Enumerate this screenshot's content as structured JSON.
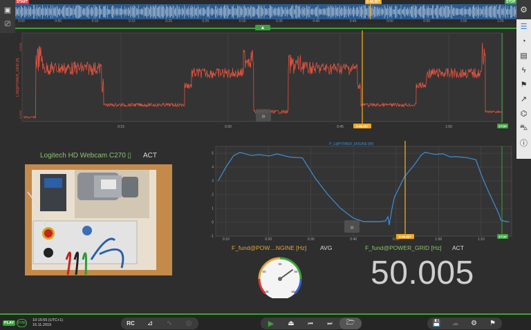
{
  "overview": {
    "start_label": "START",
    "stop_label": "STOP",
    "cursor_label": "0:46.957",
    "ticks": [
      "0:00",
      "0:05",
      "0:10",
      "0:15",
      "0:20",
      "0:25",
      "0:30",
      "0:35",
      "0:40",
      "0:45",
      "0:50",
      "0:55",
      "1:00",
      "1:05"
    ]
  },
  "top_chart": {
    "ylabel": "L1N@POWER_GRID [A]",
    "yticks": [
      "0,0000",
      "0,0000"
    ],
    "xticks": [
      "0:15",
      "0:30",
      "0:45",
      "1:00"
    ],
    "cursor_label": "0:46.957",
    "stop_label": "STOP",
    "line_color": "#e3533f",
    "cursor_color": "#f2a81d"
  },
  "webcam": {
    "title": "Logitech HD Webcam C270 ▯",
    "mode": "ACT"
  },
  "chart_data": {
    "type": "line",
    "title": "P_1@POWER_ENGINE [W]",
    "x": [
      "0:10",
      "0:20",
      "0:30",
      "0:40",
      "0:50",
      "1:00",
      "1:10"
    ],
    "yticks": [
      -1,
      0,
      1,
      2,
      3,
      4,
      5
    ],
    "ylim": [
      -1,
      5.5
    ],
    "cursor_label": "0:46.957",
    "stop_label": "STOP",
    "series": [
      {
        "color": "#3e8fd6",
        "points": [
          [
            0.07,
            3.0
          ],
          [
            0.1,
            4.0
          ],
          [
            0.13,
            4.8
          ],
          [
            0.155,
            5.1
          ],
          [
            0.2,
            4.85
          ],
          [
            0.23,
            4.9
          ],
          [
            0.27,
            4.75
          ],
          [
            0.3,
            4.9
          ],
          [
            0.35,
            4.75
          ],
          [
            0.4,
            4.6
          ],
          [
            0.45,
            3.2
          ],
          [
            0.5,
            2.0
          ],
          [
            0.55,
            1.0
          ],
          [
            0.6,
            0.3
          ],
          [
            0.64,
            0.05
          ],
          [
            0.7,
            0.05
          ],
          [
            0.725,
            0.1
          ],
          [
            0.735,
            0.4
          ],
          [
            0.74,
            -0.2
          ],
          [
            0.75,
            0.9
          ],
          [
            0.76,
            1.8
          ],
          [
            0.8,
            3.3
          ],
          [
            0.84,
            4.2
          ],
          [
            0.865,
            4.8
          ],
          [
            0.88,
            5.05
          ],
          [
            0.92,
            4.85
          ],
          [
            0.95,
            4.9
          ],
          [
            0.98,
            4.7
          ],
          [
            1.0,
            4.8
          ],
          [
            1.04,
            4.7
          ],
          [
            1.08,
            4.6
          ],
          [
            1.1,
            3.5
          ],
          [
            1.12,
            2.6
          ],
          [
            1.15,
            1.4
          ],
          [
            1.17,
            0.6
          ],
          [
            1.178,
            0.15
          ],
          [
            1.2,
            0.05
          ],
          [
            1.21,
            0.05
          ]
        ]
      }
    ]
  },
  "gauge_left": {
    "label": "F_fund@POW…NGINE [Hz]",
    "mode": "AVG",
    "ticks": [
      "45",
      "50",
      "55",
      "60",
      "65"
    ],
    "value": 59
  },
  "gauge_right": {
    "label": "F_fund@POWER_GRID [Hz]",
    "mode": "ACT",
    "value": "50.005"
  },
  "bottom": {
    "play": "PLAY",
    "sync": "SYNC",
    "time": "10:15:55 (UTC+1)",
    "date": "15.11.2019",
    "rc": "RC"
  },
  "colors": {
    "accent_green": "#3aa43a",
    "cursor_orange": "#f2a81d",
    "camera_title": "#8dc26f",
    "gauge_label": "#e0a73a"
  }
}
